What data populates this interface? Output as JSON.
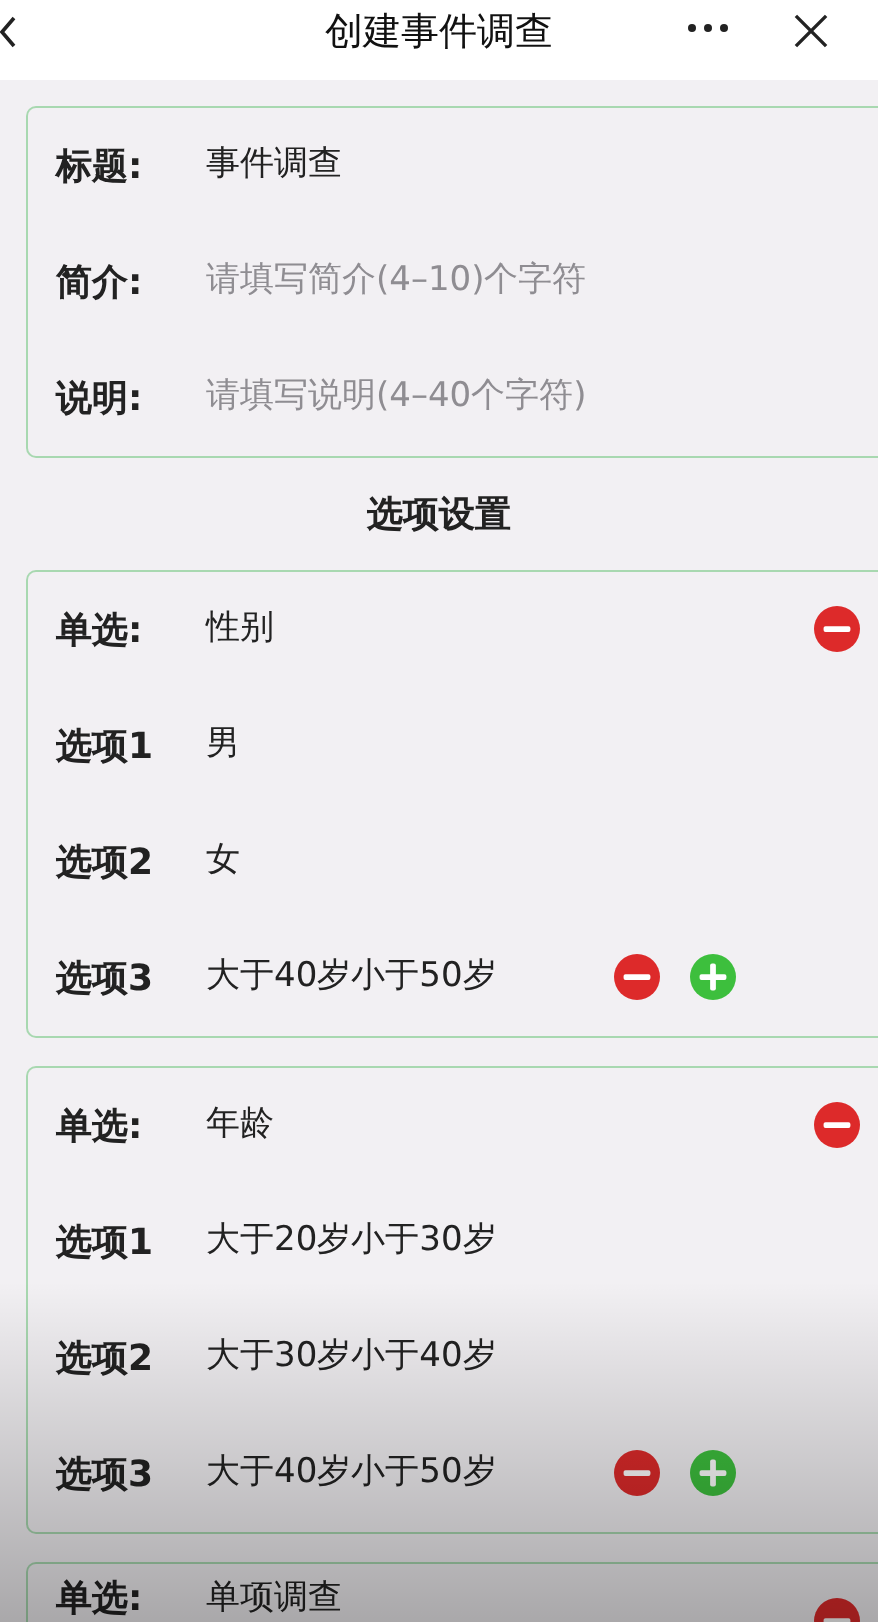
{
  "header": {
    "title": "创建事件调查"
  },
  "basics": [
    {
      "label": "标题:",
      "value": "事件调查"
    },
    {
      "label": "简介:",
      "placeholder": "请填写简介(4–10)个字符"
    },
    {
      "label": "说明:",
      "placeholder": "请填写说明(4–40个字符)"
    }
  ],
  "section_title": "选项设置",
  "questions": [
    {
      "type_label": "单选:",
      "title": "性别",
      "options": [
        {
          "label": "选项1",
          "value": "男"
        },
        {
          "label": "选项2",
          "value": "女"
        },
        {
          "label": "选项3",
          "value": "大于40岁小于50岁"
        }
      ]
    },
    {
      "type_label": "单选:",
      "title": "年龄",
      "options": [
        {
          "label": "选项1",
          "value": "大于20岁小于30岁"
        },
        {
          "label": "选项2",
          "value": "大于30岁小于40岁"
        },
        {
          "label": "选项3",
          "value": "大于40岁小于50岁"
        }
      ]
    },
    {
      "type_label": "单选:",
      "title": "单项调查"
    }
  ]
}
